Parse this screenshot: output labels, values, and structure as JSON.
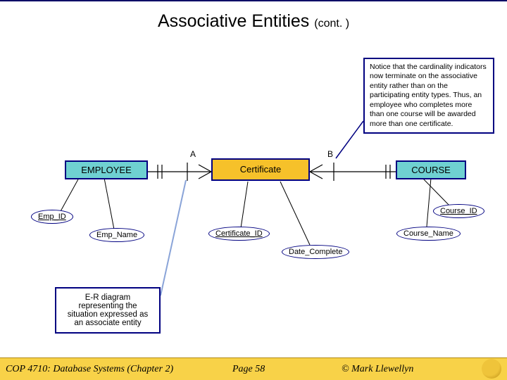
{
  "title": {
    "main": "Associative Entities ",
    "cont": "(cont. )"
  },
  "callout_text": "Notice that the cardinality indicators now terminate on the associative entity rather than on the participating entity types. Thus, an employee who completes more than one course will be awarded more than one certificate.",
  "cardinality": {
    "left_label": "A",
    "right_label": "B"
  },
  "entities": {
    "left": "EMPLOYEE",
    "assoc": "Certificate",
    "right": "COURSE"
  },
  "attributes": {
    "emp_id": "Emp_ID",
    "emp_name": "Emp_Name",
    "certificate_id": "Certificate_ID",
    "date_complete": "Date_Complete",
    "course_id": "Course_ID",
    "course_name": "Course_Name"
  },
  "small_note": "E-R diagram representing the situation expressed as an associate entity",
  "footer": {
    "left": "COP 4710: Database Systems  (Chapter 2)",
    "center": "Page 58",
    "right": "© Mark Llewellyn"
  }
}
